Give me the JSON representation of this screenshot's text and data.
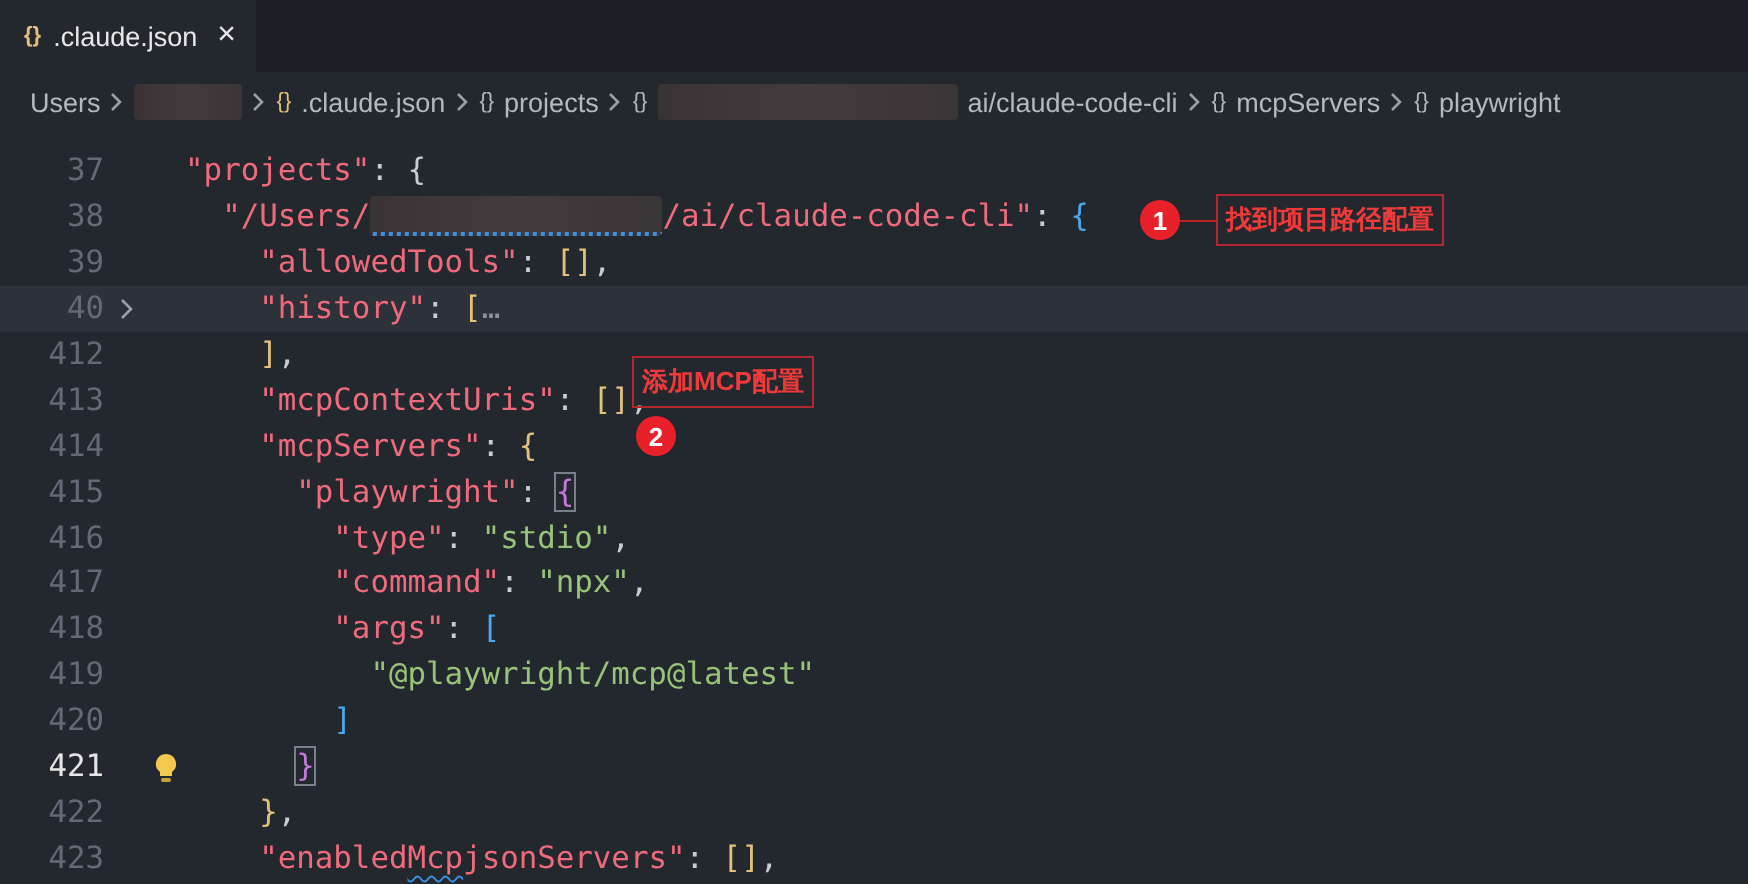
{
  "tab": {
    "icon": "{}",
    "label": ".claude.json",
    "close": "×",
    "selected": true
  },
  "breadcrumb": [
    {
      "kind": "text",
      "text": "Users"
    },
    {
      "kind": "redacted"
    },
    {
      "kind": "symbol",
      "icon": "{}",
      "text": ".claude.json"
    },
    {
      "kind": "symbol",
      "icon": "{}",
      "text": "projects"
    },
    {
      "kind": "symbol",
      "icon": "{}"
    },
    {
      "kind": "redacted"
    },
    {
      "kind": "text",
      "text": "ai/claude-code-cli"
    },
    {
      "kind": "symbol",
      "icon": "{}",
      "text": "mcpServers"
    },
    {
      "kind": "symbol",
      "icon": "{}",
      "text": "playwright"
    }
  ],
  "lines": [
    {
      "number": "37",
      "active": false,
      "fold": false,
      "hint": false,
      "tokens": [
        {
          "kind": "key",
          "text": "\"projects\""
        },
        {
          "kind": "punct",
          "text": ": {"
        }
      ],
      "children": [
        {
          "number": "38",
          "active": false,
          "fold": false,
          "hint": false,
          "tokens": [
            {
              "kind": "key",
              "text": "\"/Users/"
            },
            {
              "kind": "redacted",
              "squiggle": true
            },
            {
              "kind": "key",
              "text": "/ai/claude-code-cli\""
            },
            {
              "kind": "punct",
              "text": ": "
            },
            {
              "kind": "bracket-3",
              "text": "{"
            }
          ],
          "children": [
            {
              "number": "39",
              "active": false,
              "fold": false,
              "hint": false,
              "tokens": [
                {
                  "kind": "key",
                  "text": "\"allowedTools\""
                },
                {
                  "kind": "punct",
                  "text": ": "
                },
                {
                  "kind": "bracket-1",
                  "text": "[]"
                },
                {
                  "kind": "punct",
                  "text": ","
                }
              ]
            },
            {
              "number": "40",
              "active": false,
              "fold": true,
              "hint": false,
              "tokens": [
                {
                  "kind": "key",
                  "text": "\"history\""
                },
                {
                  "kind": "punct",
                  "text": ": "
                },
                {
                  "kind": "bracket-1",
                  "text": "["
                },
                {
                  "kind": "ellipsis",
                  "text": "…"
                }
              ]
            },
            {
              "number": "412",
              "active": false,
              "fold": false,
              "hint": false,
              "tokens": [
                {
                  "kind": "bracket-1",
                  "text": "]"
                },
                {
                  "kind": "punct",
                  "text": ","
                }
              ]
            },
            {
              "number": "413",
              "active": false,
              "fold": false,
              "hint": false,
              "tokens": [
                {
                  "kind": "key",
                  "text": "\"mcpContextUris\""
                },
                {
                  "kind": "punct",
                  "text": ": "
                },
                {
                  "kind": "bracket-1",
                  "text": "[]"
                },
                {
                  "kind": "punct",
                  "text": ","
                }
              ]
            },
            {
              "number": "414",
              "active": false,
              "fold": false,
              "hint": false,
              "tokens": [
                {
                  "kind": "key",
                  "text": "\"mcpServers\""
                },
                {
                  "kind": "punct",
                  "text": ": "
                },
                {
                  "kind": "bracket-1",
                  "text": "{"
                }
              ],
              "children": [
                {
                  "number": "415",
                  "active": false,
                  "fold": false,
                  "hint": false,
                  "tokens": [
                    {
                      "kind": "key",
                      "text": "\"playwright\""
                    },
                    {
                      "kind": "punct",
                      "text": ": "
                    },
                    {
                      "kind": "bracket-2",
                      "text": "{",
                      "matched": true
                    }
                  ],
                  "children": [
                    {
                      "number": "416",
                      "active": false,
                      "fold": false,
                      "hint": false,
                      "tokens": [
                        {
                          "kind": "key",
                          "text": "\"type\""
                        },
                        {
                          "kind": "punct",
                          "text": ": "
                        },
                        {
                          "kind": "string",
                          "text": "\"stdio\""
                        },
                        {
                          "kind": "punct",
                          "text": ","
                        }
                      ]
                    },
                    {
                      "number": "417",
                      "active": false,
                      "fold": false,
                      "hint": false,
                      "tokens": [
                        {
                          "kind": "key",
                          "text": "\"command\""
                        },
                        {
                          "kind": "punct",
                          "text": ": "
                        },
                        {
                          "kind": "string",
                          "text": "\"npx\""
                        },
                        {
                          "kind": "punct",
                          "text": ","
                        }
                      ]
                    },
                    {
                      "number": "418",
                      "active": false,
                      "fold": false,
                      "hint": false,
                      "tokens": [
                        {
                          "kind": "key",
                          "text": "\"args\""
                        },
                        {
                          "kind": "punct",
                          "text": ": "
                        },
                        {
                          "kind": "bracket-3",
                          "text": "["
                        }
                      ],
                      "children": [
                        {
                          "number": "419",
                          "active": false,
                          "fold": false,
                          "hint": false,
                          "tokens": [
                            {
                              "kind": "string",
                              "text": "\"@playwright/mcp@latest\""
                            }
                          ]
                        }
                      ]
                    },
                    {
                      "number": "420",
                      "active": false,
                      "fold": false,
                      "hint": false,
                      "tokens": [
                        {
                          "kind": "bracket-3",
                          "text": "]"
                        }
                      ]
                    }
                  ]
                },
                {
                  "number": "421",
                  "active": true,
                  "fold": false,
                  "hint": true,
                  "tokens": [
                    {
                      "kind": "bracket-2",
                      "text": "}",
                      "matched": true
                    }
                  ]
                }
              ]
            },
            {
              "number": "422",
              "active": false,
              "fold": false,
              "hint": false,
              "tokens": [
                {
                  "kind": "bracket-1",
                  "text": "}"
                },
                {
                  "kind": "punct",
                  "text": ","
                }
              ]
            },
            {
              "number": "423",
              "active": false,
              "fold": false,
              "hint": false,
              "tokens": [
                {
                  "kind": "key",
                  "text": "\"enabled"
                },
                {
                  "kind": "key",
                  "text": "Mcp",
                  "squiggle": true
                },
                {
                  "kind": "key",
                  "text": "jsonServers\""
                },
                {
                  "kind": "punct",
                  "text": ": "
                },
                {
                  "kind": "bracket-1",
                  "text": "[]"
                },
                {
                  "kind": "punct",
                  "text": ","
                }
              ]
            }
          ]
        }
      ]
    }
  ],
  "annotations": [
    {
      "number": "1",
      "label": "找到项目路径配置"
    },
    {
      "number": "2",
      "label": "添加MCP配置"
    }
  ]
}
